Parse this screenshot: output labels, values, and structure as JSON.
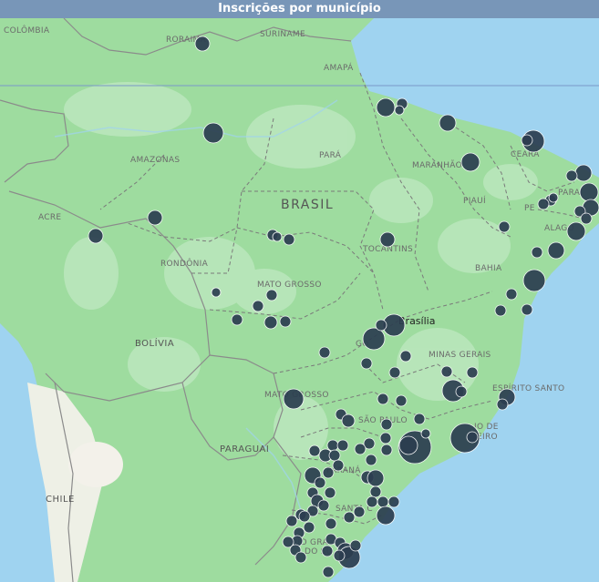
{
  "title": "Inscrições por município",
  "labels": {
    "colombia": "COLÔMBIA",
    "suriname": "SURINAME",
    "roraima": "RORAIMA",
    "amapa": "AMAPÁ",
    "amazonas": "AMAZONAS",
    "para": "PARÁ",
    "maranhao": "MARANHÃO",
    "ceara": "CEARÁ",
    "paraiba": "PARAÍ",
    "alagoas": "ALAGO",
    "pe": "PE",
    "piaui": "PIAUÍ",
    "brasil": "BRASIL",
    "acre": "ACRE",
    "rondonia": "RONDÔNIA",
    "tocantins": "TOCANTINS",
    "bahia": "BAHIA",
    "mato_grosso": "MATO GROSSO",
    "brasilia": "Brasília",
    "bolivia": "BOLÍVIA",
    "goias": "GO",
    "minas_gerais": "MINAS GERAIS",
    "espirito_santo": "ESPÍRITO SANTO",
    "mato_grosso_sul": "MATO GROSSO",
    "sao_paulo": "SÃO PAULO",
    "rio": "IO DE",
    "janeiro": "EIRO",
    "paraguai": "PARAGUAI",
    "parana": "PARANÁ",
    "santa_catarina": "SANTA C",
    "chile": "CHILE",
    "rio_grande": "RIO GRA",
    "do_sul": "DO SU"
  },
  "colors": {
    "water": "#9fd3f0",
    "land": "#9edc9f",
    "forest": "#b9e6bb",
    "dry": "#f2f1ea",
    "bubble": "#2c3e50",
    "bubble_stroke": "#ffffff"
  }
}
